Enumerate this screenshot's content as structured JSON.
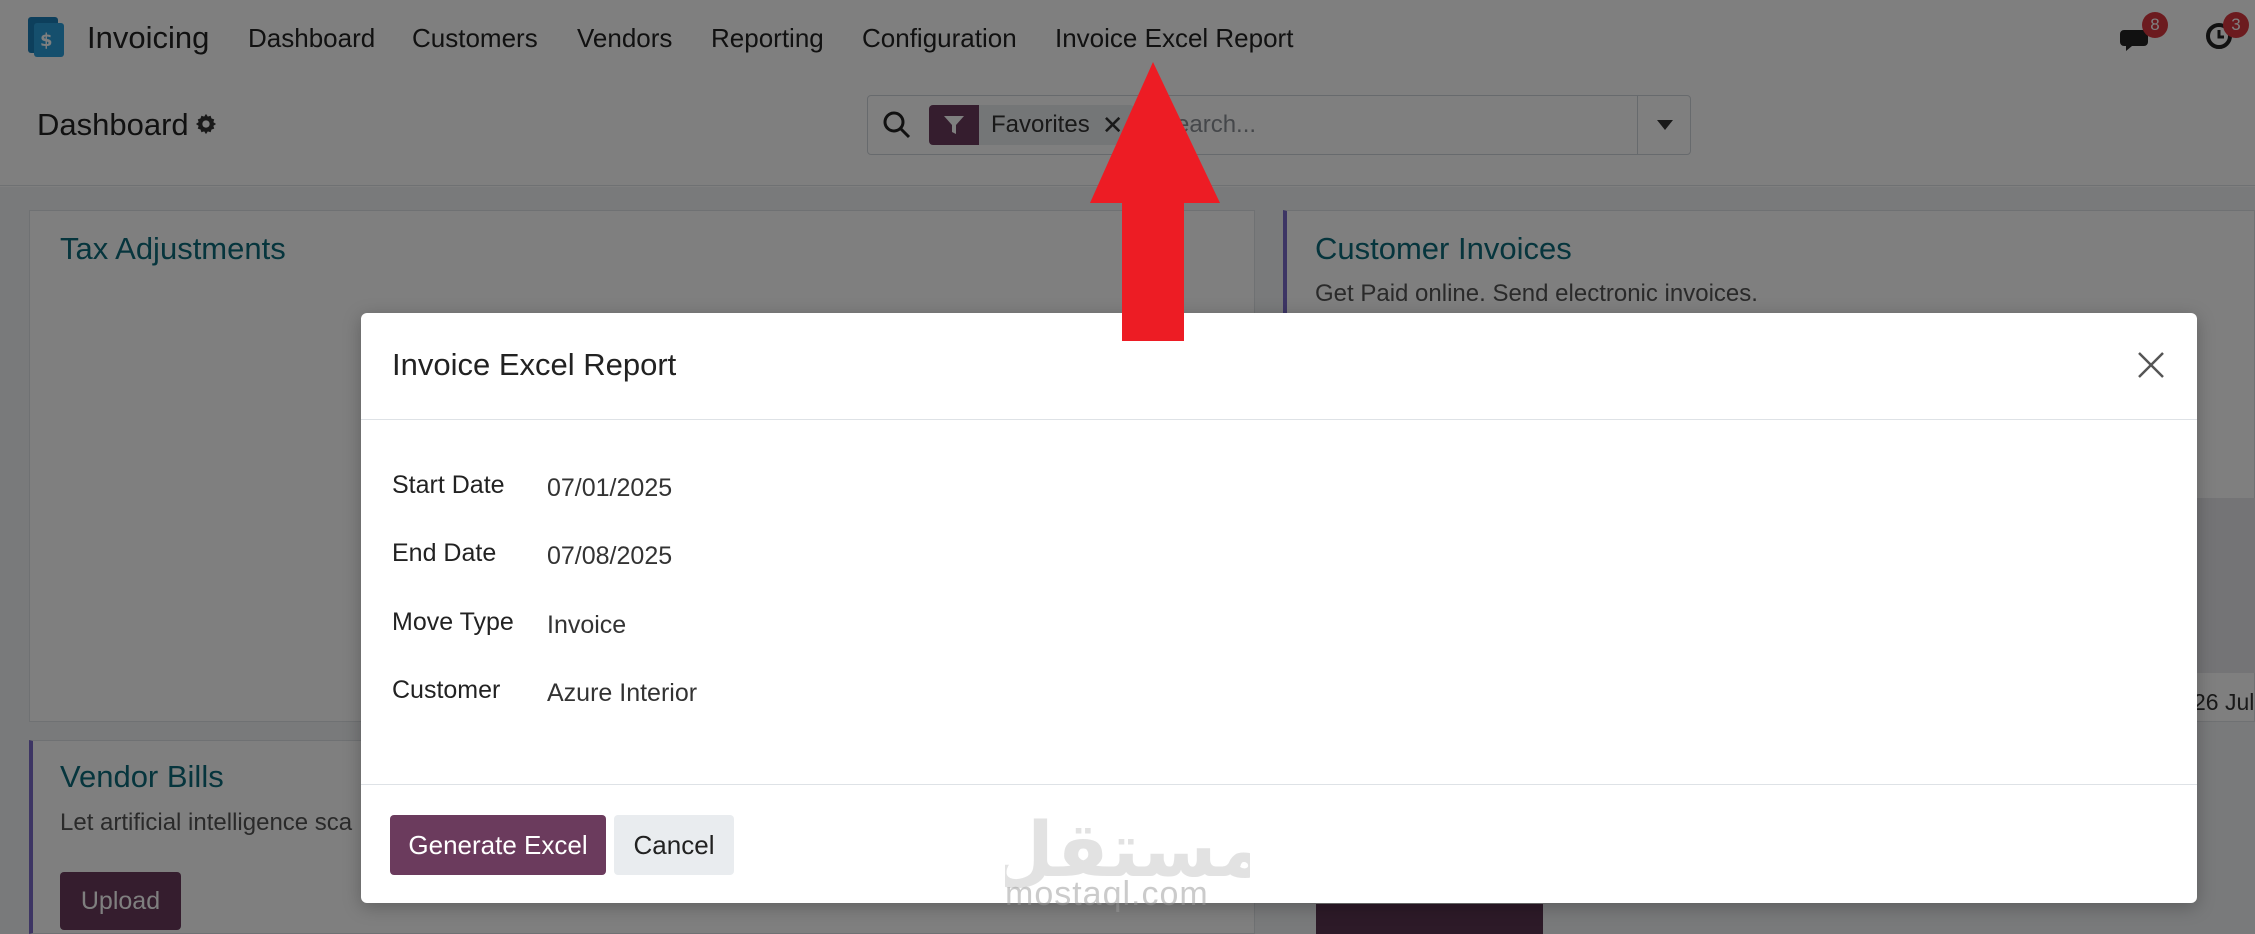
{
  "topbar": {
    "app_name": "Invoicing",
    "nav": [
      "Dashboard",
      "Customers",
      "Vendors",
      "Reporting",
      "Configuration",
      "Invoice Excel Report"
    ],
    "messages_count": "8",
    "activities_count": "3"
  },
  "control": {
    "page_title": "Dashboard",
    "facet_label": "Favorites",
    "search_placeholder": "Search..."
  },
  "cards": {
    "tax_title": "Tax Adjustments",
    "invoices_title": "Customer Invoices",
    "invoices_sub": "Get Paid online. Send electronic invoices.",
    "bills_title": "Vendor Bills",
    "bills_sub": "Let artificial intelligence sca",
    "upload_label": "Upload",
    "graph_date": "26 Jul"
  },
  "modal": {
    "title": "Invoice Excel Report",
    "fields": [
      {
        "label": "Start Date",
        "value": "07/01/2025"
      },
      {
        "label": "End Date",
        "value": "07/08/2025"
      },
      {
        "label": "Move Type",
        "value": "Invoice"
      },
      {
        "label": "Customer",
        "value": "Azure Interior"
      }
    ],
    "primary_button": "Generate Excel",
    "secondary_button": "Cancel"
  },
  "watermark": {
    "arabic": "مستقل",
    "latin": "mostaql.com"
  },
  "colors": {
    "brand": "#6b3b5d",
    "card_title": "#0d6b7a",
    "arrow": "#ed1c24",
    "badge": "#d9363e"
  }
}
